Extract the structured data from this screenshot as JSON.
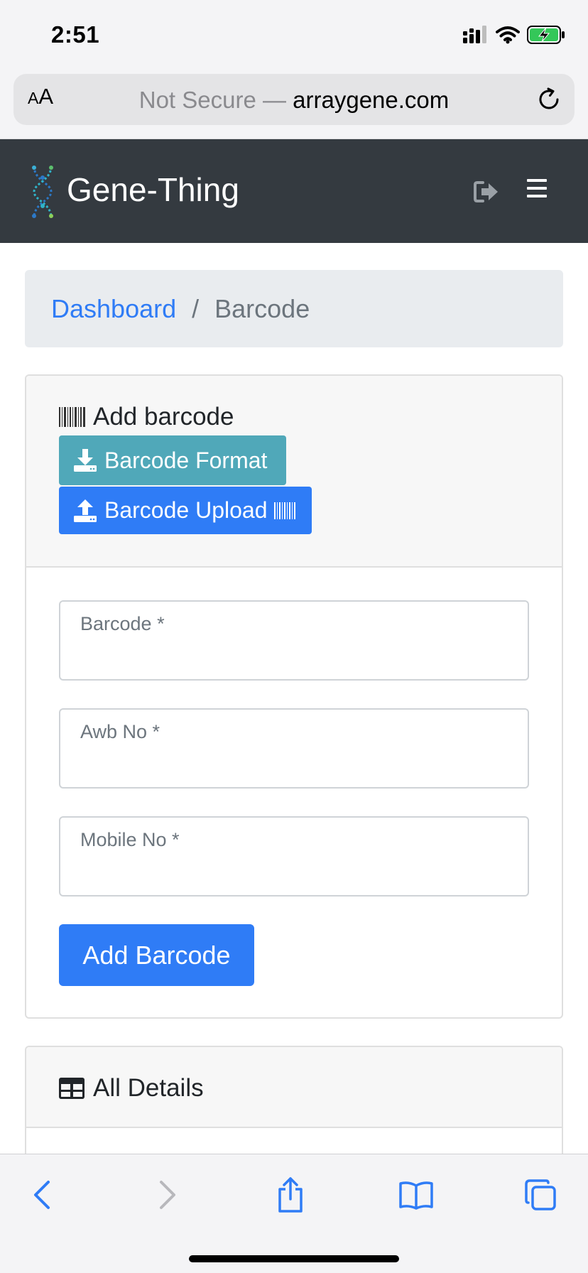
{
  "status_bar": {
    "time": "2:51",
    "icons": [
      "cellular-signal-icon",
      "wifi-icon",
      "battery-charging-icon"
    ]
  },
  "address_bar": {
    "text_size_label": "AA",
    "security_label": "Not Secure —",
    "host": "arraygene.com"
  },
  "navbar": {
    "brand": "Gene-Thing",
    "icons": [
      "logout-icon",
      "hamburger-menu-icon"
    ],
    "colors": {
      "background": "#343a40"
    }
  },
  "breadcrumb": {
    "items": [
      {
        "label": "Dashboard"
      },
      {
        "label": "Barcode"
      }
    ],
    "separator": "/"
  },
  "add_card": {
    "title": "Add barcode",
    "title_icon": "barcode-icon",
    "format_button": "Barcode Format",
    "upload_button": "Barcode Upload",
    "fields": [
      {
        "label": "Barcode *",
        "value": ""
      },
      {
        "label": "Awb No *",
        "value": ""
      },
      {
        "label": "Mobile No *",
        "value": ""
      }
    ],
    "submit_label": "Add Barcode",
    "colors": {
      "primary": "#2f7cf6",
      "info": "#50a8b9"
    }
  },
  "details_card": {
    "title": "All Details",
    "title_icon": "table-icon"
  },
  "toolbar": {
    "items": [
      "back-icon",
      "forward-icon",
      "share-icon",
      "bookmarks-icon",
      "tabs-icon"
    ]
  }
}
